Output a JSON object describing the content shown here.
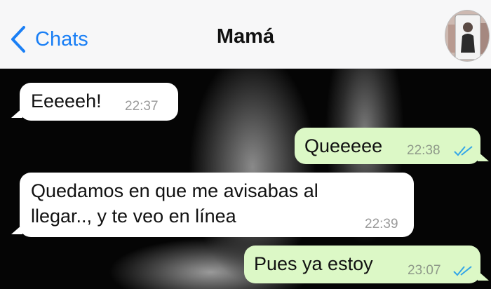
{
  "header": {
    "back_label": "Chats",
    "title": "Mamá",
    "back_icon": "chevron-left-icon",
    "accent_color": "#1a7ff5"
  },
  "messages": [
    {
      "direction": "incoming",
      "text": "Eeeeeh!",
      "time": "22:37"
    },
    {
      "direction": "outgoing",
      "text": "Queeeee",
      "time": "22:38",
      "status": "read"
    },
    {
      "direction": "incoming",
      "text_lines": [
        "Quedamos en que me avisabas al",
        "llegar.., y te veo en línea"
      ],
      "time": "22:39"
    },
    {
      "direction": "outgoing",
      "text": "Pues ya estoy",
      "time": "23:07",
      "status": "read"
    }
  ],
  "colors": {
    "incoming_bubble": "#ffffff",
    "outgoing_bubble": "#dcf8c6",
    "read_ticks": "#34a6e8"
  }
}
